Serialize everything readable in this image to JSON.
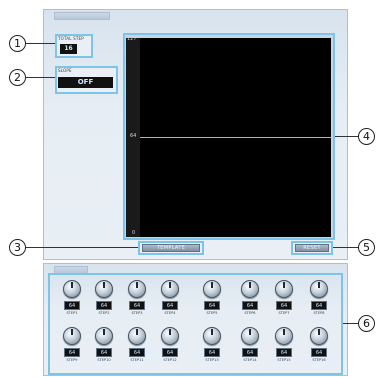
{
  "panel": {
    "title": "",
    "values_title": ""
  },
  "total_step": {
    "label": "TOTAL STEP",
    "value": "16"
  },
  "slope": {
    "label": "SLOPE",
    "value": "OFF"
  },
  "graph": {
    "y_max": "127",
    "y_mid": "64",
    "y_min": "0",
    "level": 64
  },
  "buttons": {
    "template": "TEMPLATE",
    "reset": "RESET"
  },
  "steps_row1": [
    {
      "value": "64",
      "label": "STEP1"
    },
    {
      "value": "64",
      "label": "STEP2"
    },
    {
      "value": "64",
      "label": "STEP3"
    },
    {
      "value": "64",
      "label": "STEP4"
    },
    {
      "value": "64",
      "label": "STEP5"
    },
    {
      "value": "64",
      "label": "STEP6"
    },
    {
      "value": "64",
      "label": "STEP7"
    },
    {
      "value": "64",
      "label": "STEP8"
    }
  ],
  "steps_row2": [
    {
      "value": "64",
      "label": "STEP9"
    },
    {
      "value": "64",
      "label": "STEP10"
    },
    {
      "value": "64",
      "label": "STEP11"
    },
    {
      "value": "64",
      "label": "STEP12"
    },
    {
      "value": "64",
      "label": "STEP13"
    },
    {
      "value": "64",
      "label": "STEP14"
    },
    {
      "value": "64",
      "label": "STEP15"
    },
    {
      "value": "64",
      "label": "STEP16"
    }
  ],
  "callouts": [
    "1",
    "2",
    "3",
    "4",
    "5",
    "6"
  ],
  "colors": {
    "accent": "#7cc4e8",
    "panel": "#e6edf4",
    "display_bg": "#111111"
  }
}
